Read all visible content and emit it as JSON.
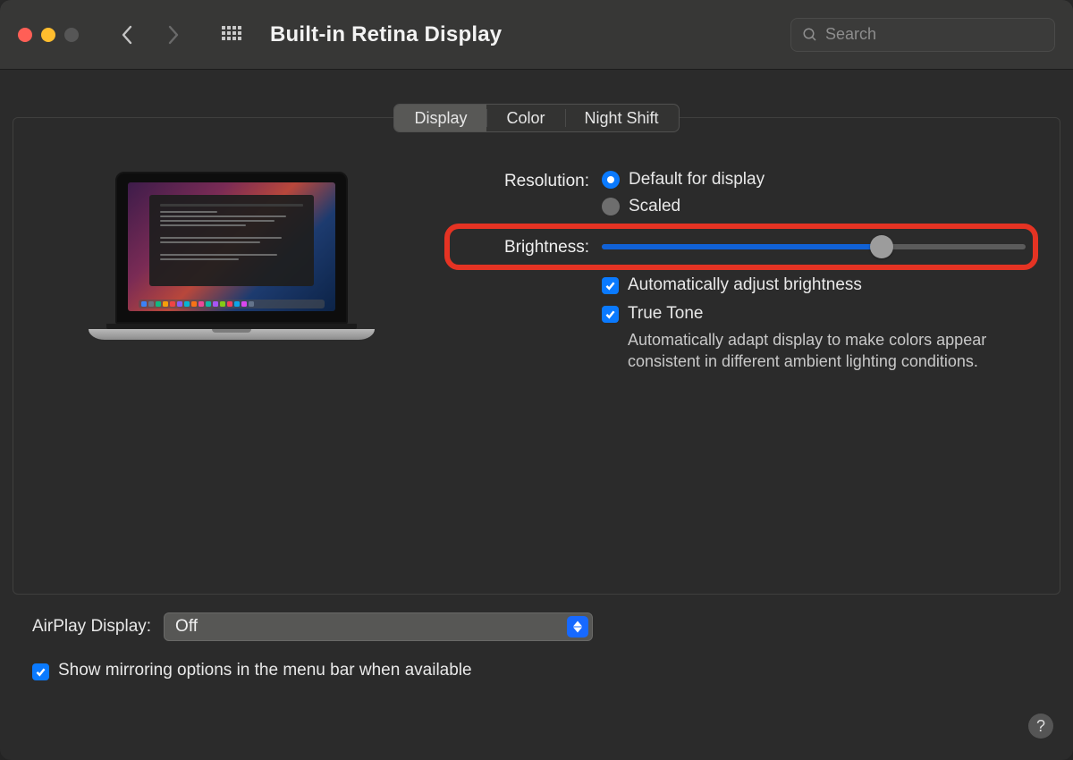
{
  "header": {
    "title": "Built-in Retina Display",
    "search_placeholder": "Search"
  },
  "tabs": {
    "items": [
      "Display",
      "Color",
      "Night Shift"
    ],
    "active": 0
  },
  "resolution": {
    "label": "Resolution:",
    "options": [
      "Default for display",
      "Scaled"
    ],
    "selected": 0
  },
  "brightness": {
    "label": "Brightness:",
    "value_percent": 66
  },
  "auto_brightness": {
    "label": "Automatically adjust brightness",
    "checked": true
  },
  "true_tone": {
    "label": "True Tone",
    "checked": true,
    "description": "Automatically adapt display to make colors appear consistent in different ambient lighting conditions."
  },
  "airplay": {
    "label": "AirPlay Display:",
    "value": "Off"
  },
  "mirroring": {
    "label": "Show mirroring options in the menu bar when available",
    "checked": true
  },
  "help_label": "?"
}
